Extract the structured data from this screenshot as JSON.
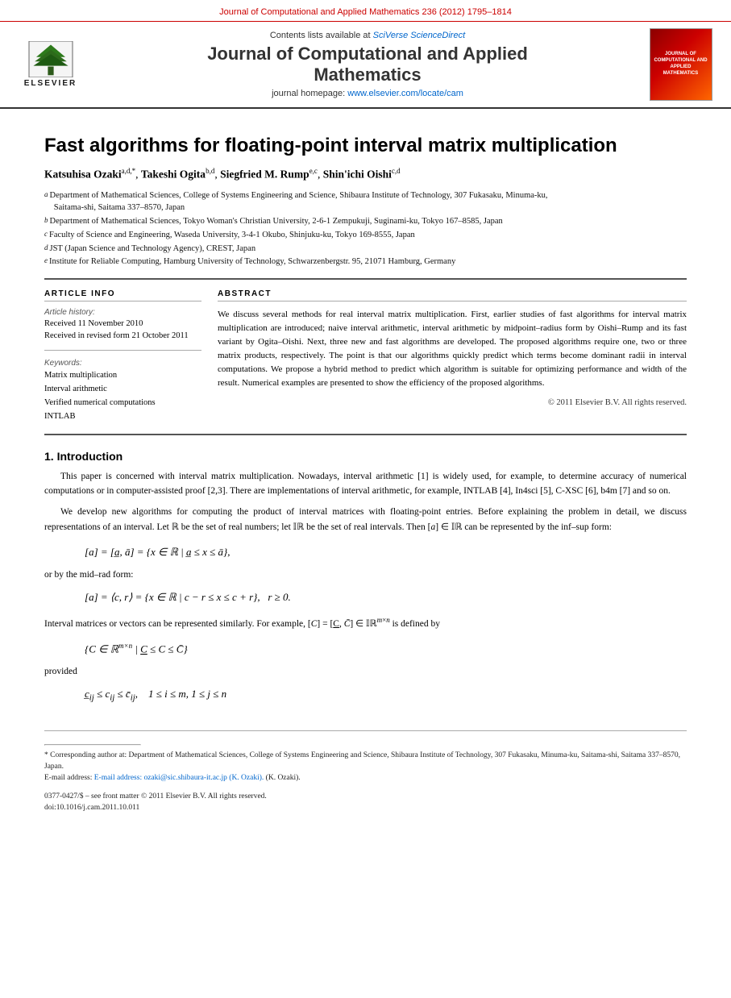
{
  "topbar": {
    "text": "Journal of Computational and Applied Mathematics 236 (2012) 1795–1814"
  },
  "header": {
    "sciverse_text": "Contents lists available at ",
    "sciverse_link": "SciVerse ScienceDirect",
    "journal_title_line1": "Journal of Computational and Applied",
    "journal_title_line2": "Mathematics",
    "homepage_text": "journal homepage: ",
    "homepage_link": "www.elsevier.com/locate/cam",
    "elsevier_text": "ELSEVIER",
    "cover_text": "JOURNAL OF\nCOMPUTATIONAL AND\nAPPLIED\nMATHEMATICS"
  },
  "article": {
    "title": "Fast algorithms for floating-point interval matrix multiplication",
    "authors": "Katsuhisa Ozaki a,d,*, Takeshi Ogita b,d, Siegfried M. Rump e,c, Shin'ichi Oishi c,d",
    "affiliations": [
      {
        "letter": "a",
        "text": "Department of Mathematical Sciences, College of Systems Engineering and Science, Shibaura Institute of Technology, 307 Fukasaku, Minuma-ku, Saitama-shi, Saitama 337–8570, Japan"
      },
      {
        "letter": "b",
        "text": "Department of Mathematical Sciences, Tokyo Woman's Christian University, 2-6-1 Zempukuji, Suginami-ku, Tokyo 167–8585, Japan"
      },
      {
        "letter": "c",
        "text": "Faculty of Science and Engineering, Waseda University, 3-4-1 Okubo, Shinjuku-ku, Tokyo 169-8555, Japan"
      },
      {
        "letter": "d",
        "text": "JST (Japan Science and Technology Agency), CREST, Japan"
      },
      {
        "letter": "e",
        "text": "Institute for Reliable Computing, Hamburg University of Technology, Schwarzenbergstr. 95, 21071 Hamburg, Germany"
      }
    ]
  },
  "article_info": {
    "section_label": "ARTICLE INFO",
    "history_label": "Article history:",
    "received_1": "Received 11 November 2010",
    "received_2": "Received in revised form 21 October 2011",
    "keywords_label": "Keywords:",
    "keyword_1": "Matrix multiplication",
    "keyword_2": "Interval arithmetic",
    "keyword_3": "Verified numerical computations",
    "keyword_4": "INTLAB"
  },
  "abstract": {
    "section_label": "ABSTRACT",
    "text": "We discuss several methods for real interval matrix multiplication. First, earlier studies of fast algorithms for interval matrix multiplication are introduced; naive interval arithmetic, interval arithmetic by midpoint–radius form by Oishi–Rump and its fast variant by Ogita–Oishi. Next, three new and fast algorithms are developed. The proposed algorithms require one, two or three matrix products, respectively. The point is that our algorithms quickly predict which terms become dominant radii in interval computations. We propose a hybrid method to predict which algorithm is suitable for optimizing performance and width of the result. Numerical examples are presented to show the efficiency of the proposed algorithms.",
    "copyright": "© 2011 Elsevier B.V. All rights reserved."
  },
  "intro": {
    "heading": "1. Introduction",
    "para1": "This paper is concerned with interval matrix multiplication. Nowadays, interval arithmetic [1] is widely used, for example, to determine accuracy of numerical computations or in computer-assisted proof [2,3]. There are implementations of interval arithmetic, for example, INTLAB [4], In4sci [5], C-XSC [6], b4m [7] and so on.",
    "para2": "We develop new algorithms for computing the product of interval matrices with floating-point entries. Before explaining the problem in detail, we discuss representations of an interval. Let ℝ be the set of real numbers; let 𝕀ℝ be the set of real intervals. Then [a] ∈ 𝕀ℝ can be represented by the inf–sup form:",
    "math_infsup": "[a] = [a̲, ā] = {x ∈ ℝ | a̲ ≤ x ≤ ā},",
    "or_line": "or by the mid–rad form:",
    "math_midrad": "[a] = ⟨c, r⟩ = {x ∈ ℝ | c − r ≤ x ≤ c + r},   r ≥ 0.",
    "para3": "Interval matrices or vectors can be represented similarly. For example, [C] = [C̲, C̄] ∈ 𝕀ℝ^(m×n) is defined by",
    "math_set": "{C ∈ ℝ^(m×n) | C̲ ≤ C ≤ C̄}",
    "provided_line": "provided",
    "math_element": "c̲ᵢⱼ ≤ cᵢⱼ ≤ c̄ᵢⱼ,   1 ≤ i ≤ m, 1 ≤ j ≤ n"
  },
  "footnotes": {
    "star": "* Corresponding author at: Department of Mathematical Sciences, College of Systems Engineering and Science, Shibaura Institute of Technology, 307 Fukasaku, Minuma-ku, Saitama-shi, Saitama 337–8570, Japan.",
    "email": "E-mail address: ozaki@sic.shibaura-it.ac.jp (K. Ozaki).",
    "issn": "0377-0427/$ – see front matter © 2011 Elsevier B.V. All rights reserved.",
    "doi": "doi:10.1016/j.cam.2011.10.011"
  }
}
